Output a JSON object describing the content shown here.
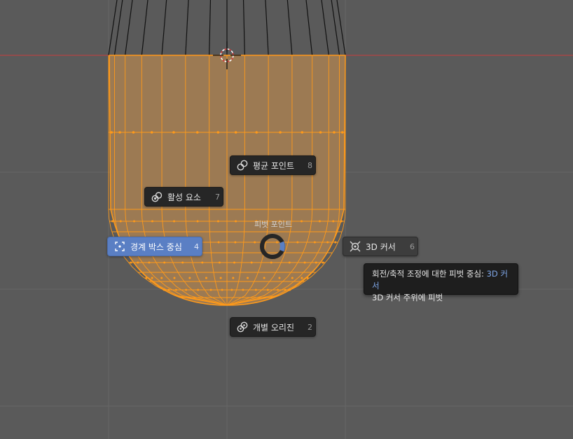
{
  "pie_menu": {
    "title": "피벗 포인트",
    "items": [
      {
        "id": "median",
        "label": "평균 포인트",
        "shortcut": "8",
        "icon": "median-point-icon"
      },
      {
        "id": "active",
        "label": "활성 요소",
        "shortcut": "7",
        "icon": "active-element-icon"
      },
      {
        "id": "bbox",
        "label": "경계 박스 중심",
        "shortcut": "4",
        "icon": "bounding-box-center-icon",
        "highlighted": true
      },
      {
        "id": "cursor",
        "label": "3D 커서",
        "shortcut": "6",
        "icon": "3d-cursor-icon"
      },
      {
        "id": "individual",
        "label": "개별 오리진",
        "shortcut": "2",
        "icon": "individual-origins-icon"
      }
    ]
  },
  "tooltip": {
    "line1_prefix": "회전/축적 조정에 대한 피벗 중심: ",
    "line1_value": "3D 커서",
    "line2": "3D 커서 주위에 피벗"
  },
  "colors": {
    "viewport_bg": "#5a5a5a",
    "grid_line": "#666666",
    "x_axis": "#b54545",
    "mesh_selected": "#ff9a1a",
    "mesh_fill": "#9c7a53",
    "menu_bg": "#262626",
    "menu_active": "#5a7fc4",
    "tooltip_value": "#7fa7e8"
  }
}
